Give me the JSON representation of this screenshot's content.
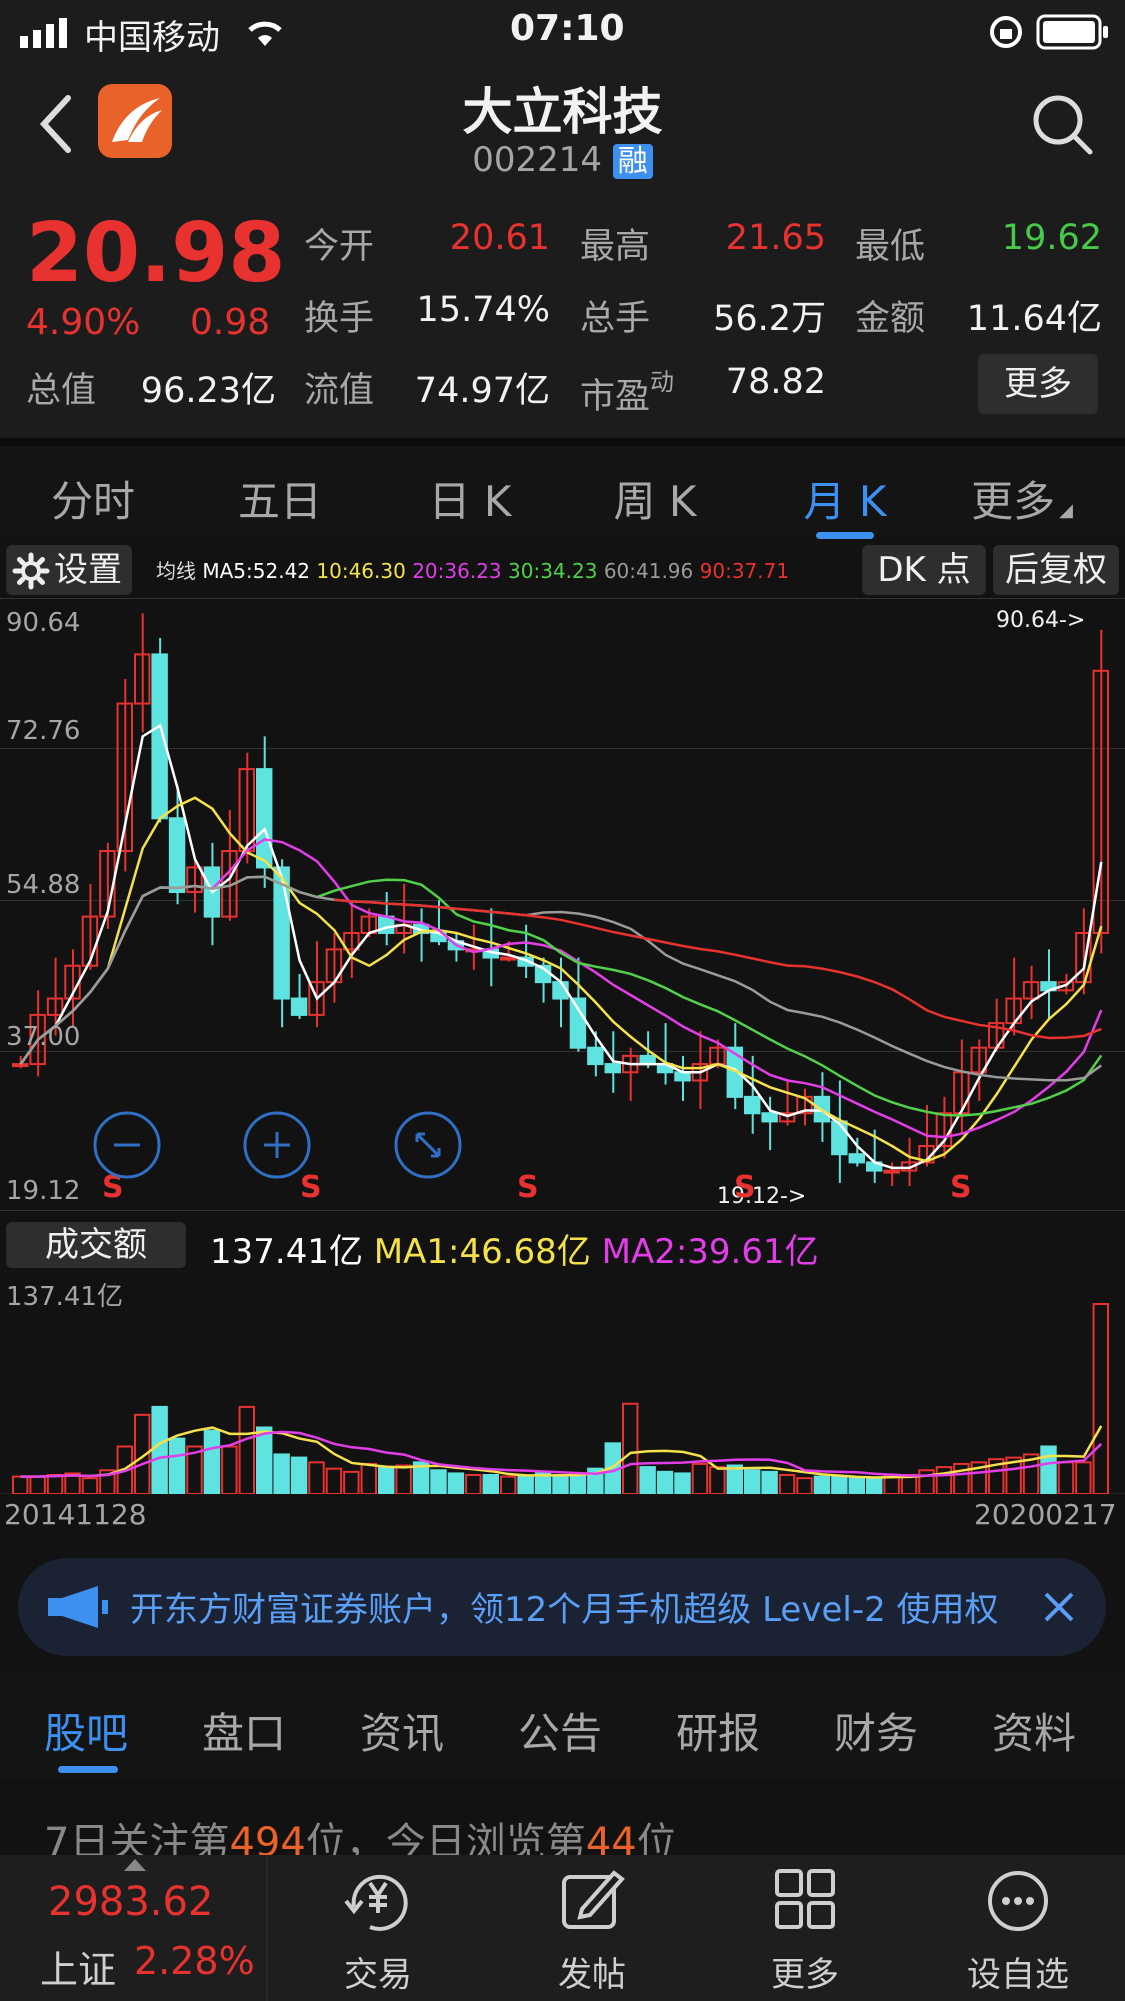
{
  "status_bar": {
    "carrier": "中国移动",
    "time": "07:10"
  },
  "header": {
    "title": "大立科技",
    "code": "002214",
    "badge": "融"
  },
  "quote": {
    "price": "20.98",
    "change_pct": "4.90%",
    "change_abs": "0.98",
    "open_label": "今开",
    "open": "20.61",
    "high_label": "最高",
    "high": "21.65",
    "low_label": "最低",
    "low": "19.62",
    "turnover_label": "换手",
    "turnover": "15.74%",
    "volume_label": "总手",
    "volume": "56.2万",
    "amount_label": "金额",
    "amount": "11.64亿",
    "mcap_label": "总值",
    "mcap": "96.23亿",
    "float_label": "流值",
    "float": "74.97亿",
    "pe_label": "市盈",
    "pe_sup": "动",
    "pe": "78.82",
    "more_button": "更多"
  },
  "period_tabs": [
    "分时",
    "五日",
    "日 K",
    "周 K",
    "月 K",
    "更多"
  ],
  "active_period": 4,
  "ma_line": {
    "settings": "设置",
    "prefix": "均线",
    "ma5": "MA5:52.42",
    "ma10": "10:46.30",
    "ma20": "20:36.23",
    "ma30": "30:34.23",
    "ma60": "60:41.96",
    "ma90": "90:37.71",
    "dk_button": "DK 点",
    "fq_button": "后复权"
  },
  "chart_data": {
    "type": "candlestick",
    "y_labels": [
      "90.64",
      "72.76",
      "54.88",
      "37.00",
      "19.12"
    ],
    "ylim": [
      19.12,
      90.64
    ],
    "max_marker": "90.64->",
    "min_marker": "19.12->",
    "sell_markers": [
      "S",
      "S",
      "S",
      "S",
      "S"
    ],
    "volume_label": "成交额",
    "volume_value": "137.41亿",
    "vol_ma1": "MA1:46.68亿",
    "vol_ma2": "MA2:39.61亿",
    "volume_max_label": "137.41亿",
    "start_date": "20141128",
    "end_date": "20200217"
  },
  "colors": {
    "up": "#e8322f",
    "down": "#5fe3e0",
    "accent": "#3d8ff0",
    "ma5": "#ffffff",
    "ma10": "#f5e14a",
    "ma20": "#e23ee8",
    "ma30": "#52d04a",
    "ma60": "#9a9a9a",
    "ma90": "#e8322f"
  },
  "promo": {
    "text": "开东方财富证券账户，领12个月手机超级 Level-2 使用权"
  },
  "bottom_tabs": [
    "股吧",
    "盘口",
    "资讯",
    "公告",
    "研报",
    "财务",
    "资料"
  ],
  "active_bottom_tab": 0,
  "rank_line": {
    "p1": "7日关注第",
    "n1": "494",
    "p2": "位，今日浏览第",
    "n2": "44",
    "p3": "位"
  },
  "dock": {
    "index_value": "2983.62",
    "index_name": "上证",
    "index_change": "2.28%",
    "items": [
      "交易",
      "发帖",
      "更多",
      "设自选"
    ]
  }
}
